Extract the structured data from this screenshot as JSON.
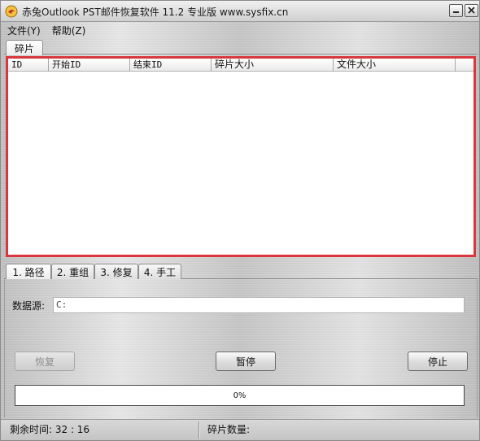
{
  "window": {
    "title": "赤兔Outlook PST邮件恢复软件 11.2 专业版 www.sysfix.cn",
    "minimize_icon": "minimize-icon",
    "close_icon": "close-icon",
    "app_icon": "app-logo-icon"
  },
  "menu": {
    "items": [
      {
        "label": "文件(Y)"
      },
      {
        "label": "帮助(Z)"
      }
    ]
  },
  "fragments": {
    "tab_label": "碎片",
    "columns": [
      "ID",
      "开始ID",
      "结束ID",
      "碎片大小",
      "文件大小"
    ],
    "rows": [],
    "highlight_color": "#d9373d"
  },
  "steps": {
    "tabs": [
      {
        "label": "1. 路径",
        "active": true
      },
      {
        "label": "2. 重组",
        "active": false
      },
      {
        "label": "3. 修复",
        "active": false
      },
      {
        "label": "4. 手工",
        "active": false
      }
    ],
    "source_label": "数据源:",
    "source_value": "C:",
    "buttons": {
      "recover": "恢复",
      "pause": "暂停",
      "stop": "停止"
    },
    "progress": {
      "value": 0,
      "text": "0%"
    }
  },
  "status": {
    "remaining_time": "剩余时间: 32 : 16",
    "fragment_count": "碎片数量:"
  }
}
